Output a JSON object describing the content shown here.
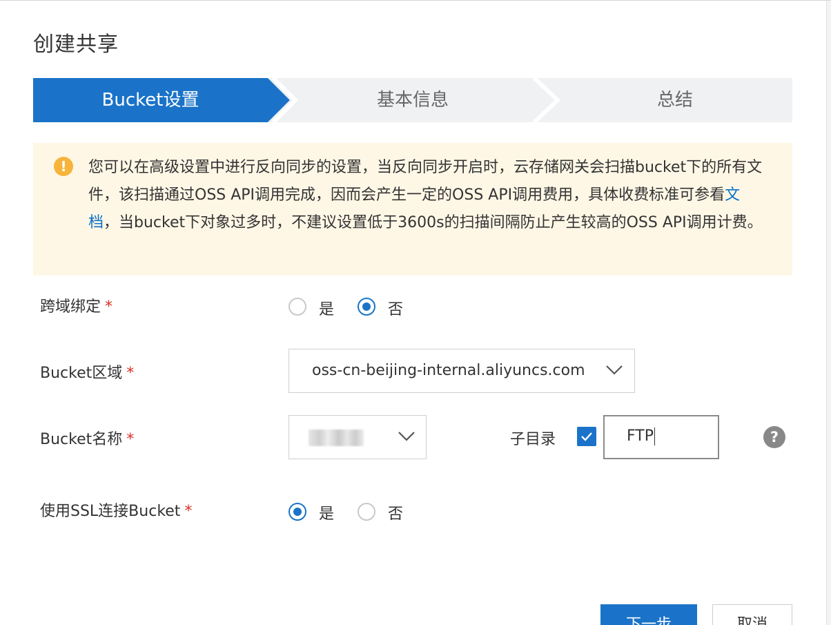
{
  "dialog": {
    "title": "创建共享"
  },
  "steps": [
    {
      "label": "Bucket设置",
      "state": "active"
    },
    {
      "label": "基本信息",
      "state": "pending"
    },
    {
      "label": "总结",
      "state": "pending"
    }
  ],
  "notice": {
    "icon": "warning-exclamation-icon",
    "text_before_link": "您可以在高级设置中进行反向同步的设置，当反向同步开启时，云存储网关会扫描bucket下的所有文件，该扫描通过OSS API调用完成，因而会产生一定的OSS API调用费用，具体收费标准可参看",
    "link_text": "文档",
    "text_after_link": "，当bucket下对象过多时，不建议设置低于3600s的扫描间隔防止产生较高的OSS API调用计费。"
  },
  "form": {
    "cross_domain": {
      "label": "跨域绑定",
      "required_mark": "*",
      "options": [
        {
          "label": "是",
          "checked": false
        },
        {
          "label": "否",
          "checked": true
        }
      ]
    },
    "bucket_region": {
      "label": "Bucket区域",
      "required_mark": "*",
      "value": "oss-cn-beijing-internal.aliyuncs.com"
    },
    "bucket_name": {
      "label": "Bucket名称",
      "required_mark": "*",
      "subdir_label": "子目录",
      "subdir_checked": true,
      "subdir_value": "FTP"
    },
    "use_ssl": {
      "label": "使用SSL连接Bucket",
      "required_mark": "*",
      "options": [
        {
          "label": "是",
          "checked": true
        },
        {
          "label": "否",
          "checked": false
        }
      ]
    }
  },
  "footer": {
    "next_label": "下一步",
    "cancel_label": "取消"
  },
  "colors": {
    "primary": "#1a73c8",
    "notice_bg": "#fff7e6",
    "warning": "#f6b43a",
    "required": "#d93026"
  }
}
